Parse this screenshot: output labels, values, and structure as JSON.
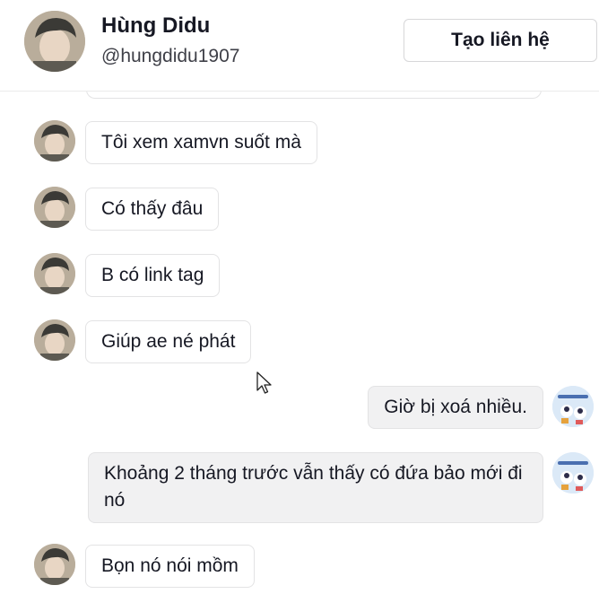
{
  "header": {
    "name": "Hùng Didu",
    "username": "@hungdidu1907",
    "contact_button": "Tạo liên hệ"
  },
  "messages": [
    {
      "direction": "received",
      "text": "Tôi xem xamvn suốt mà"
    },
    {
      "direction": "received",
      "text": "Có thấy đâu"
    },
    {
      "direction": "received",
      "text": "B có link tag"
    },
    {
      "direction": "received",
      "text": "Giúp ae né phát"
    },
    {
      "direction": "sent",
      "text": "Giờ bị xoá nhiều."
    },
    {
      "direction": "sent",
      "text": "Khoảng 2 tháng trước vẫn thấy có đứa bảo mới đi nó"
    },
    {
      "direction": "received",
      "text": "Bọn nó nói mồm"
    }
  ],
  "icons": {
    "header_avatar": "profile-photo-icon",
    "sender_avatar": "profile-photo-icon",
    "self_avatar": "cartoon-avatar-icon",
    "cursor": "mouse-pointer-icon"
  },
  "colors": {
    "text": "#161823",
    "received_bubble": "#ffffff",
    "sent_bubble": "#f1f1f2",
    "border": "#e3e3e4"
  }
}
